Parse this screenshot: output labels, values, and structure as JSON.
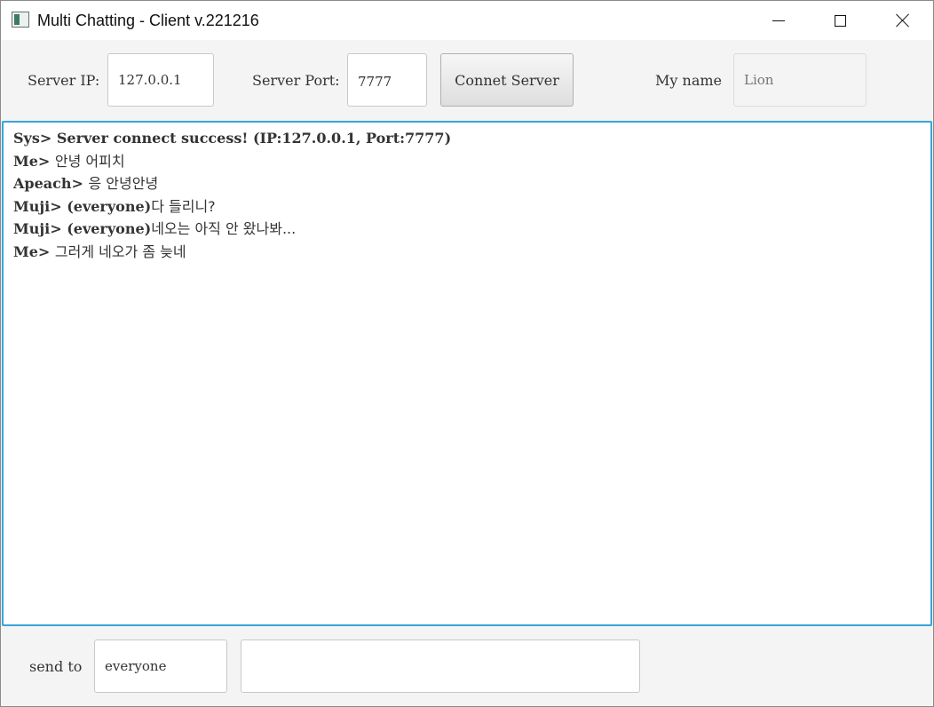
{
  "window": {
    "title": "Multi Chatting - Client v.221216"
  },
  "connection": {
    "server_ip_label": "Server IP:",
    "server_ip_value": "127.0.0.1",
    "server_port_label": "Server Port:",
    "server_port_value": "7777",
    "connect_button_label": "Connet Server",
    "my_name_label": "My name",
    "my_name_placeholder": "Lion"
  },
  "messages": [
    {
      "prefix": "Sys> ",
      "recipient": "",
      "text": "Server connect success! (IP:127.0.0.1, Port:7777)",
      "text_bold": true
    },
    {
      "prefix": "Me> ",
      "recipient": "",
      "text": "안녕 어피치",
      "text_bold": false
    },
    {
      "prefix": "Apeach> ",
      "recipient": "",
      "text": "응 안녕안녕",
      "text_bold": false
    },
    {
      "prefix": "Muji> ",
      "recipient": "(everyone)",
      "text": "다 들리니?",
      "text_bold": false
    },
    {
      "prefix": "Muji> ",
      "recipient": "(everyone)",
      "text": "네오는 아직 안 왔나봐...",
      "text_bold": false
    },
    {
      "prefix": "Me> ",
      "recipient": "",
      "text": "그러게 네오가 좀 늦네",
      "text_bold": false
    }
  ],
  "footer": {
    "send_to_label": "send to",
    "send_to_value": "everyone",
    "message_value": ""
  },
  "colors": {
    "chat_focus_border": "#39a3d9",
    "window_background": "#f4f4f4"
  }
}
